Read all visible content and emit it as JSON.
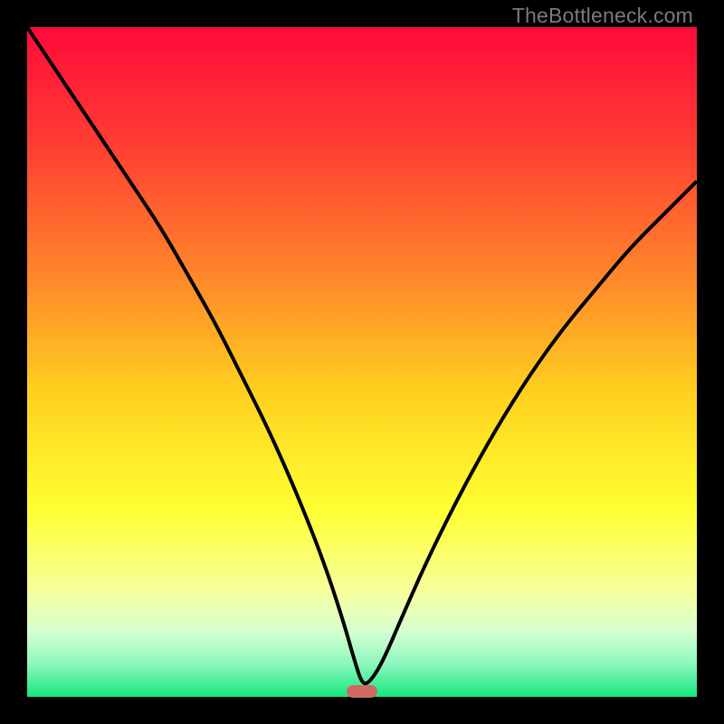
{
  "watermark": "TheBottleneck.com",
  "chart_data": {
    "type": "line",
    "title": "",
    "xlabel": "",
    "ylabel": "",
    "xlim": [
      0,
      100
    ],
    "ylim": [
      0,
      100
    ],
    "series": [
      {
        "name": "bottleneck-curve",
        "x": [
          0,
          4,
          8,
          12,
          16,
          20,
          24,
          28,
          32,
          36,
          40,
          44,
          47,
          49,
          50,
          51,
          53,
          56,
          60,
          65,
          70,
          75,
          80,
          85,
          90,
          95,
          100
        ],
        "y": [
          100,
          94,
          88,
          82,
          76,
          70,
          63,
          56,
          48,
          40,
          31,
          21,
          12,
          5,
          2,
          2,
          5,
          12,
          21,
          31,
          40,
          48,
          55,
          61,
          67,
          72,
          77
        ]
      }
    ],
    "gradient_stops": [
      {
        "offset": 0.0,
        "color": "#ff0a3a"
      },
      {
        "offset": 0.18,
        "color": "#ff3f33"
      },
      {
        "offset": 0.38,
        "color": "#ff8a2a"
      },
      {
        "offset": 0.55,
        "color": "#ffd21f"
      },
      {
        "offset": 0.72,
        "color": "#ffff33"
      },
      {
        "offset": 0.84,
        "color": "#f6ff9a"
      },
      {
        "offset": 0.9,
        "color": "#d9ffd0"
      },
      {
        "offset": 0.95,
        "color": "#8ef7c0"
      },
      {
        "offset": 1.0,
        "color": "#15e87c"
      }
    ],
    "marker": {
      "x": 50,
      "y": 0.8,
      "color": "#cf6a62"
    }
  }
}
